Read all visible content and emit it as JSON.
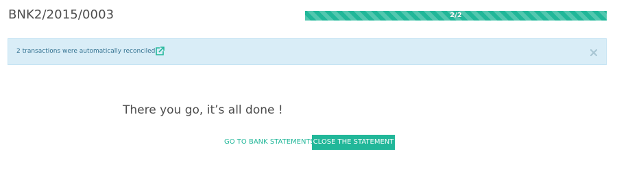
{
  "header": {
    "title": "BNK2/2015/0003"
  },
  "progress": {
    "text": "2/2",
    "fraction": 1.0
  },
  "alert": {
    "message": "2 transactions were automatically reconciled.",
    "open_icon": "external-link-icon",
    "close_icon": "close-icon"
  },
  "main": {
    "done_text": "There you go, it’s all done !",
    "go_to_statements_label": "GO TO BANK STATEMENTS",
    "close_statement_label": "CLOSE THE STATEMENT"
  },
  "colors": {
    "accent": "#21b799",
    "alert_bg": "#d9edf7",
    "alert_text": "#31708f",
    "text": "#4c4c4c"
  }
}
